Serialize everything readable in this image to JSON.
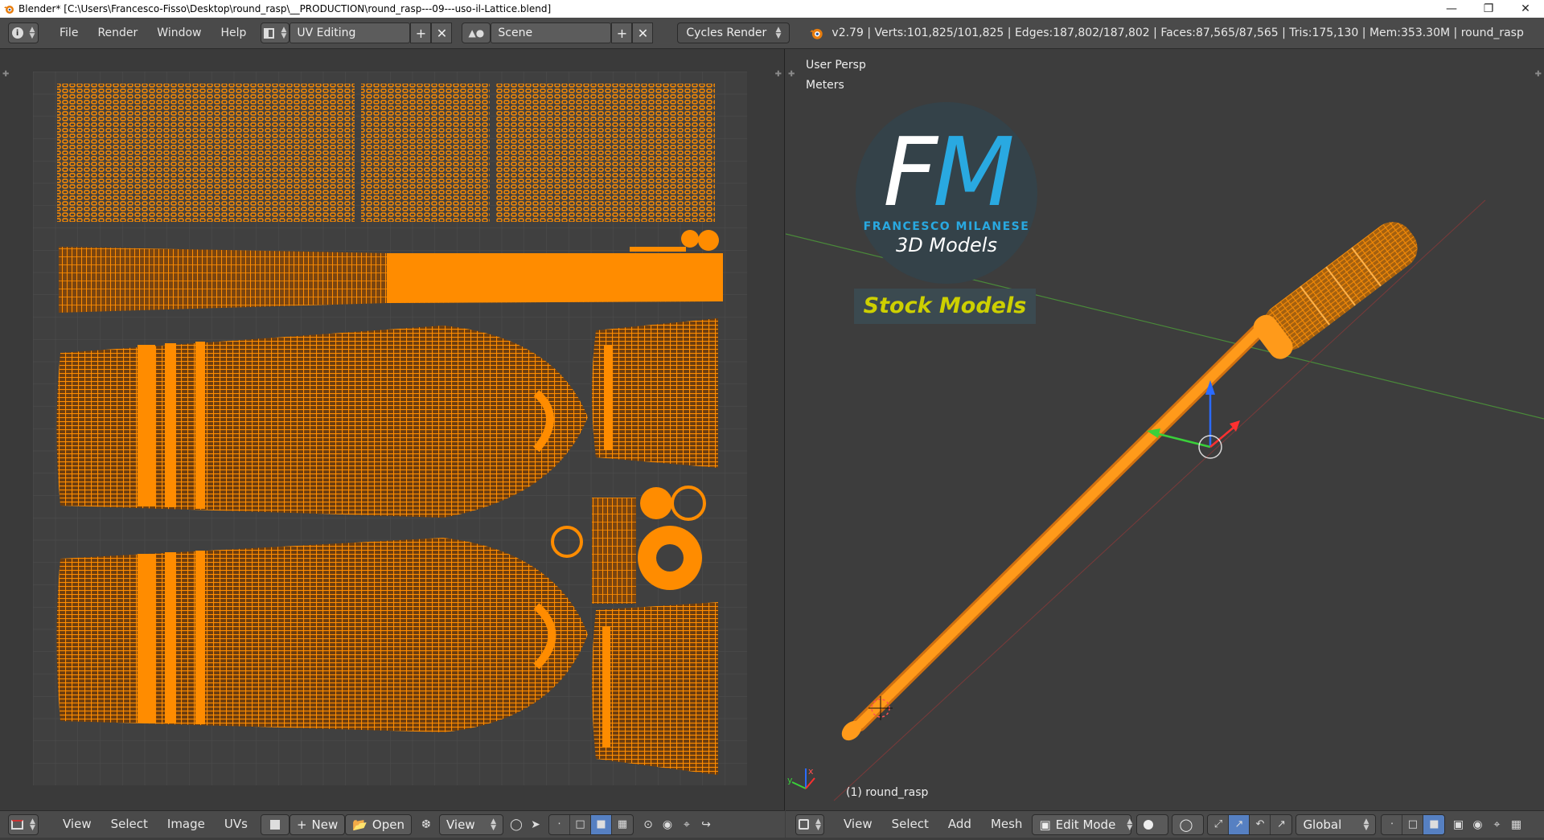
{
  "window": {
    "title": "Blender* [C:\\Users\\Francesco-Fisso\\Desktop\\round_rasp\\__PRODUCTION\\round_rasp---09---uso-il-Lattice.blend]",
    "minimize_icon": "minimize-icon",
    "restore_icon": "restore-icon",
    "close_icon": "close-icon"
  },
  "info_header": {
    "menus": [
      "File",
      "Render",
      "Window",
      "Help"
    ],
    "screen_layout": "UV Editing",
    "scene": "Scene",
    "render_engine": "Cycles Render",
    "stats": "v2.79 | Verts:101,825/101,825 | Edges:187,802/187,802 | Faces:87,565/87,565 | Tris:175,130 | Mem:353.30M | round_rasp"
  },
  "uv_editor": {
    "menus": [
      "View",
      "Select",
      "Image",
      "UVs"
    ],
    "new_label": "New",
    "open_label": "Open",
    "view_label": "View"
  },
  "viewport": {
    "view_name": "User Persp",
    "units": "Meters",
    "object_label": "(1) round_rasp",
    "menus": [
      "View",
      "Select",
      "Add",
      "Mesh"
    ],
    "mode": "Edit Mode",
    "orientation": "Global",
    "axis_x": "x",
    "axis_y": "y"
  },
  "logo": {
    "letter_f": "F",
    "letter_m": "M",
    "name": "FRANCESCO MILANESE",
    "subtitle": "3D Models",
    "banner": "Stock Models"
  },
  "colors": {
    "accent_orange": "#ff8c00",
    "header_bg": "#4a4a4a",
    "logo_blue": "#29a9e1",
    "banner_text": "#cdd000"
  }
}
